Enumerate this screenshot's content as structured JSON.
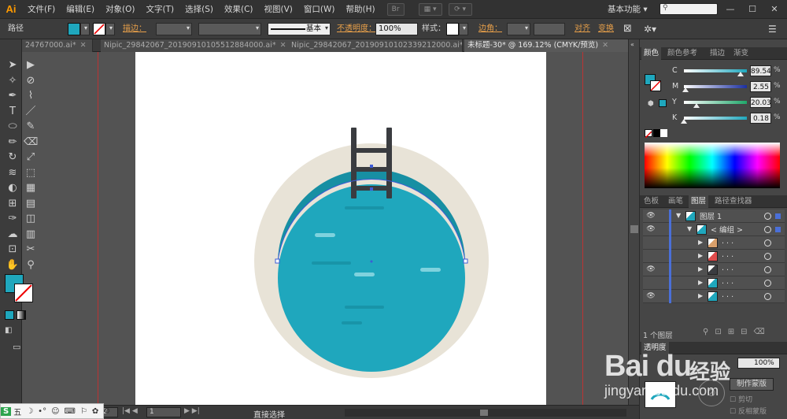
{
  "app": {
    "logo": "Ai"
  },
  "menu": [
    "文件(F)",
    "编辑(E)",
    "对象(O)",
    "文字(T)",
    "选择(S)",
    "效果(C)",
    "视图(V)",
    "窗口(W)",
    "帮助(H)"
  ],
  "menubar_icons": [
    "Br",
    "▦ ▾",
    "⟳ ▾"
  ],
  "workspace": {
    "label": "基本功能 ▾",
    "search_placeholder": ""
  },
  "window_controls": [
    "—",
    "☐",
    "✕"
  ],
  "control_bar": {
    "selection_label": "路径",
    "fill_color": "#1fa7bd",
    "stroke_label": "描边：",
    "stroke_profile": "基本",
    "opacity_label": "不透明度：",
    "opacity_value": "100%",
    "style_label": "样式：",
    "corner_label": "边角：",
    "align_label": "对齐",
    "transform_label": "变换"
  },
  "tabs": [
    {
      "label": "24767000.ai*",
      "close": "✕",
      "active": false
    },
    {
      "label": "Nipic_29842067_20190910105512884000.ai*",
      "close": "✕",
      "active": false
    },
    {
      "label": "Nipic_29842067_20190910102339212000.ai*",
      "close": "✕",
      "active": false
    },
    {
      "label": "未标题-30* @ 169.12% (CMYK/预览)",
      "close": "✕",
      "active": true
    }
  ],
  "tools": {
    "icons": [
      "selection-tool-icon",
      "direct-selection-tool-icon",
      "magic-wand-icon",
      "lasso-icon",
      "pen-icon",
      "curvature-icon",
      "type-icon",
      "line-icon",
      "ellipse-icon",
      "paintbrush-icon",
      "pencil-icon",
      "eraser-icon",
      "rotate-icon",
      "scale-icon",
      "warp-icon",
      "free-transform-icon",
      "shape-builder-icon",
      "perspective-icon",
      "mesh-icon",
      "gradient-icon",
      "eyedropper-icon",
      "blend-icon",
      "symbol-sprayer-icon",
      "graph-icon",
      "artboard-icon",
      "slice-icon",
      "hand-icon",
      "zoom-icon"
    ],
    "glyphs": [
      "➤",
      "▶",
      "✧",
      "⊘",
      "✒",
      "⌇",
      "T",
      "／",
      "⬭",
      "✎",
      "✏",
      "⌫",
      "↻",
      "⤢",
      "≋",
      "⬚",
      "◐",
      "▦",
      "⊞",
      "▤",
      "✑",
      "◫",
      "☁",
      "▥",
      "⊡",
      "✂",
      "✋",
      "⚲"
    ],
    "fill_swatch": "#1fa7bd"
  },
  "status_bar": {
    "zoom": "2",
    "page": "1",
    "tool_name": "直接选择"
  },
  "panel_color": {
    "tabs": [
      "颜色",
      "颜色参考",
      "描边",
      "渐变"
    ],
    "channels": [
      {
        "label": "C",
        "value": "89.54",
        "pct": 0.895,
        "track": "#1fa7bd"
      },
      {
        "label": "M",
        "value": "2.55",
        "pct": 0.025,
        "track": "#1b2fa0"
      },
      {
        "label": "Y",
        "value": "20.03",
        "pct": 0.2,
        "track": "#1fa76a"
      },
      {
        "label": "K",
        "value": "0.18",
        "pct": 0.002,
        "track": "#1fa7bd"
      }
    ],
    "pct_sign": "%"
  },
  "panel_layers": {
    "tabs": [
      "色板",
      "画笔",
      "图层",
      "路径查找器"
    ],
    "rows": [
      {
        "name": "图层 1",
        "indent": 0,
        "visible": true
      },
      {
        "name": "< 编组 >",
        "indent": 1,
        "visible": true
      },
      {
        "name": ". . .",
        "indent": 2,
        "visible": false
      },
      {
        "name": ". . .",
        "indent": 2,
        "visible": false
      },
      {
        "name": ". . .",
        "indent": 2,
        "visible": true
      },
      {
        "name": ". . .",
        "indent": 2,
        "visible": false
      },
      {
        "name": ". . .",
        "indent": 2,
        "visible": true
      }
    ],
    "footer": "1 个图层"
  },
  "panel_transparency": {
    "tab": "透明度",
    "opacity": "100%",
    "make_mask": "制作蒙版",
    "clip": "剪切",
    "invert_mask": "反相蒙版"
  },
  "watermark": {
    "brand": "Bai du",
    "cn": "经验",
    "url": "jingyan.baidu.com"
  },
  "ime_bar": [
    "S",
    "五",
    "☽",
    "•°",
    "☺",
    "⌨",
    "⚐",
    "✿",
    "⚙"
  ],
  "artwork": {
    "pool_rim_color": "#e8e3d7",
    "water_color": "#1fa7bd",
    "ladder_color": "#3a3c40"
  }
}
